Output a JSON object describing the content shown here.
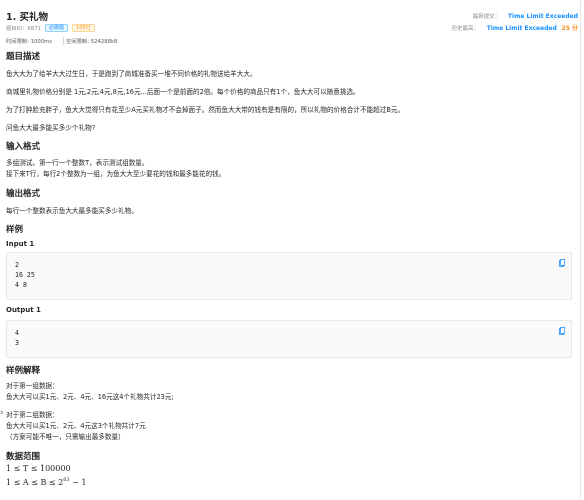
{
  "problem": {
    "title": "1. 买礼物",
    "id_label": "题目ID：6871",
    "tag_required": "必做题",
    "tag_score": "100分",
    "time_limit": "时间限制: 1000ms",
    "memory_limit": "空间限制: 524288kB"
  },
  "status": {
    "latest_label": "最新提交：",
    "latest_value": "Time Limit Exceeded",
    "best_label": "历史最高：",
    "best_value": "Time Limit Exceeded",
    "best_score": "25 分"
  },
  "sections": {
    "description_title": "题目描述",
    "description_lines": [
      "鱼大大为了给羊大大过生日，于是跑到了商城准备买一堆不同价格的礼物送给羊大大。",
      "商城里礼物价格分别是 1元,2元,4元,8元,16元...后面一个是前面的2倍。每个价格的商品只有1个，鱼大大可以随意挑选。",
      "为了打肿脸充胖子，鱼大大觉得只有花至少A元买礼物才不会掉面子。然而鱼大大带的钱有是有限的，所以礼物的价格合计不能超过B元。",
      "问鱼大大最多能买多少个礼物?"
    ],
    "input_title": "输入格式",
    "input_lines": [
      "多组测试。第一行一个整数T，表示测试组数量。",
      "接下来T行，每行2个整数为一组，为鱼大大至少要花的钱和最多能花的钱。"
    ],
    "output_title": "输出格式",
    "output_lines": [
      "每行一个整数表示鱼大大最多能买多少礼物。"
    ],
    "samples_title": "样例",
    "input1_label": "Input 1",
    "input1_lines": [
      "2",
      "16 25",
      "4 8"
    ],
    "output1_label": "Output 1",
    "output1_lines": [
      "4",
      "3"
    ],
    "explain_title": "样例解释",
    "explain_lines": [
      "对于第一组数据：",
      "鱼大大可以买1元、2元、4元、16元这4个礼物共计23元;",
      "对于第二组数据：",
      "鱼大大可以买1元、2元、4元这3个礼物共计7元",
      "（方案可能不唯一，只需输出最多数量）"
    ],
    "range_title": "数据范围",
    "range_line1": "1 ≤ T ≤ 100000",
    "range_line2_prefix": "1 ≤ A ≤ B ≤ 2",
    "range_line2_exp": "63",
    "range_line2_suffix": " − 1"
  },
  "icons": {
    "copy": "copy-icon",
    "drag_handle": "chevron-right-icon"
  },
  "colors": {
    "accent_blue": "#1890ff",
    "accent_orange": "#fa8c16"
  }
}
